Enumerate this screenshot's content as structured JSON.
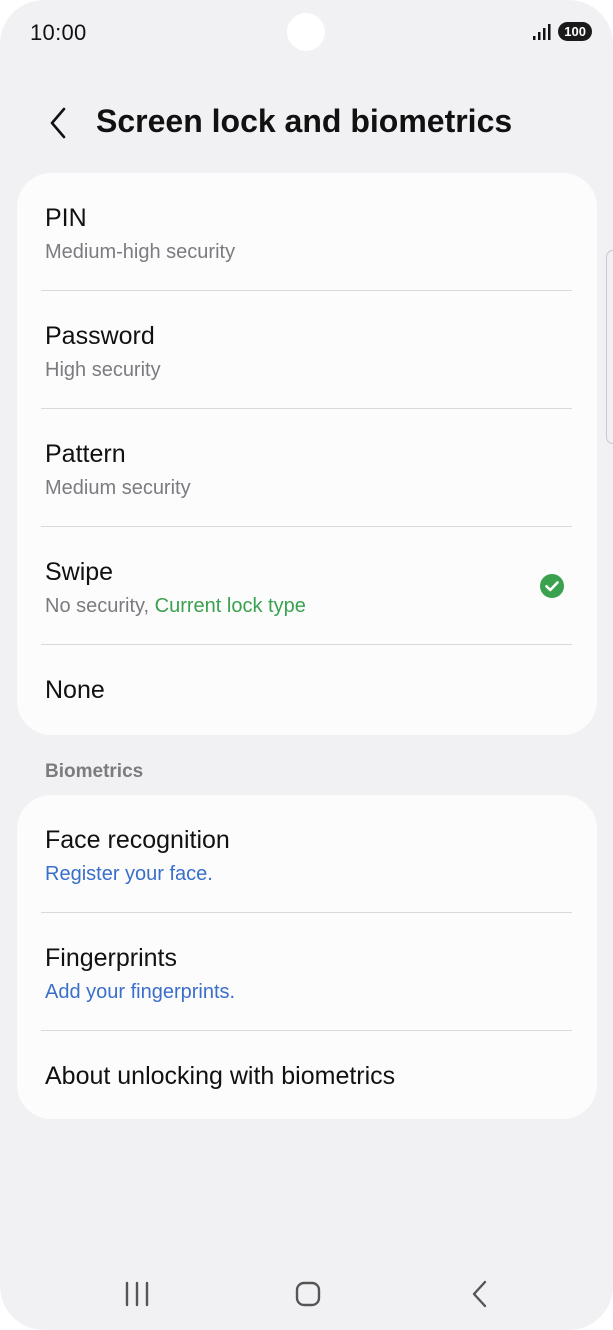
{
  "status_bar": {
    "time": "10:00",
    "battery": "100"
  },
  "header": {
    "title": "Screen lock and biometrics"
  },
  "lock_types": [
    {
      "title": "PIN",
      "subtitle": "Medium-high security"
    },
    {
      "title": "Password",
      "subtitle": "High security"
    },
    {
      "title": "Pattern",
      "subtitle": "Medium security"
    },
    {
      "title": "Swipe",
      "subtitle": "No security, ",
      "subtitle_accent": "Current lock type",
      "selected": true
    },
    {
      "title": "None"
    }
  ],
  "biometrics": {
    "section_title": "Biometrics",
    "items": [
      {
        "title": "Face recognition",
        "subtitle": "Register your face."
      },
      {
        "title": "Fingerprints",
        "subtitle": "Add your fingerprints."
      },
      {
        "title": "About unlocking with biometrics"
      }
    ]
  },
  "colors": {
    "accent_green": "#3aa14f",
    "link_blue": "#3a6fc9"
  },
  "icons": {
    "back": "chevron-left-icon",
    "selected": "check-circle-icon",
    "nav_recents": "recents-icon",
    "nav_home": "home-icon",
    "nav_back": "back-icon"
  }
}
